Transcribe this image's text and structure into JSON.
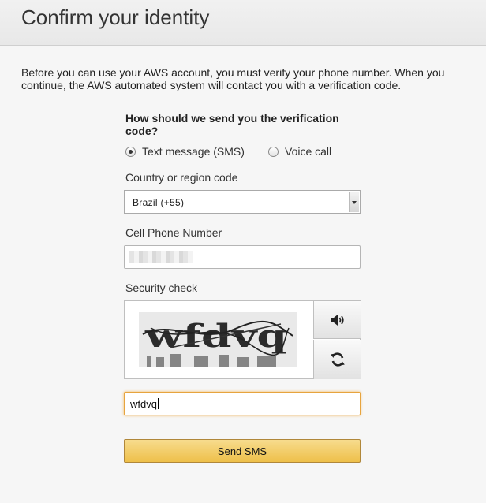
{
  "header": {
    "title": "Confirm your identity"
  },
  "intro": "Before you can use your AWS account, you must verify your phone number. When you continue, the AWS automated system will contact you with a verification code.",
  "method": {
    "question": "How should we send you the verification code?",
    "options": [
      {
        "label": "Text message (SMS)",
        "selected": true
      },
      {
        "label": "Voice call",
        "selected": false
      }
    ]
  },
  "country": {
    "label": "Country or region code",
    "value": "Brazil (+55)"
  },
  "phone": {
    "label": "Cell Phone Number",
    "value": ""
  },
  "security": {
    "label": "Security check",
    "captcha_text": "wfdvq",
    "answer": "wfdvq"
  },
  "submit": {
    "label": "Send SMS"
  },
  "icons": {
    "audio": "speaker-icon",
    "refresh": "refresh-icon"
  },
  "colors": {
    "submit_bg": "#eec04a",
    "focus_border": "#e7a43e"
  }
}
